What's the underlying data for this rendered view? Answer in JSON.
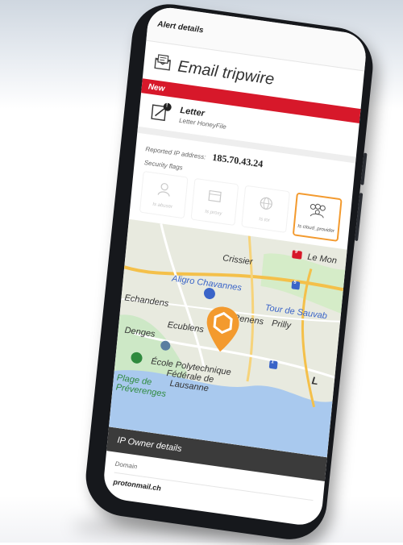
{
  "header": {
    "title": "Alert details"
  },
  "alert": {
    "heading": "Email tripwire",
    "status": "New"
  },
  "item": {
    "title": "Letter",
    "subtitle": "Letter HoneyFile",
    "badge": "!"
  },
  "ip": {
    "label": "Reported IP address:",
    "value": "185.70.43.24"
  },
  "security_flags": {
    "label": "Security flags",
    "items": [
      {
        "label": "Is abuser",
        "active": false,
        "icon": "user-shield-icon"
      },
      {
        "label": "Is proxy",
        "active": false,
        "icon": "proxy-icon"
      },
      {
        "label": "Is tor",
        "active": false,
        "icon": "globe-icon"
      },
      {
        "label": "Is cloud_provider",
        "active": true,
        "icon": "cloud-provider-icon"
      }
    ]
  },
  "map": {
    "places": [
      "Crissier",
      "Le Mon",
      "Aligro Chavannes",
      "Tour de Sauvab",
      "Echandens",
      "Renens",
      "Prilly",
      "Ecublens",
      "Denges",
      "École Polytechnique Fédérale de Lausanne",
      "Plage de Préverenges",
      "L"
    ],
    "road_badges": [
      "9",
      "5",
      "1"
    ],
    "pin_color": "#f39a2e"
  },
  "owner": {
    "section_title": "IP Owner details",
    "domain_label": "Domain",
    "domain_value": "protonmail.ch"
  },
  "colors": {
    "accent_red": "#d7182a",
    "accent_orange": "#f39a2e",
    "dark_bar": "#3b3b3b"
  }
}
